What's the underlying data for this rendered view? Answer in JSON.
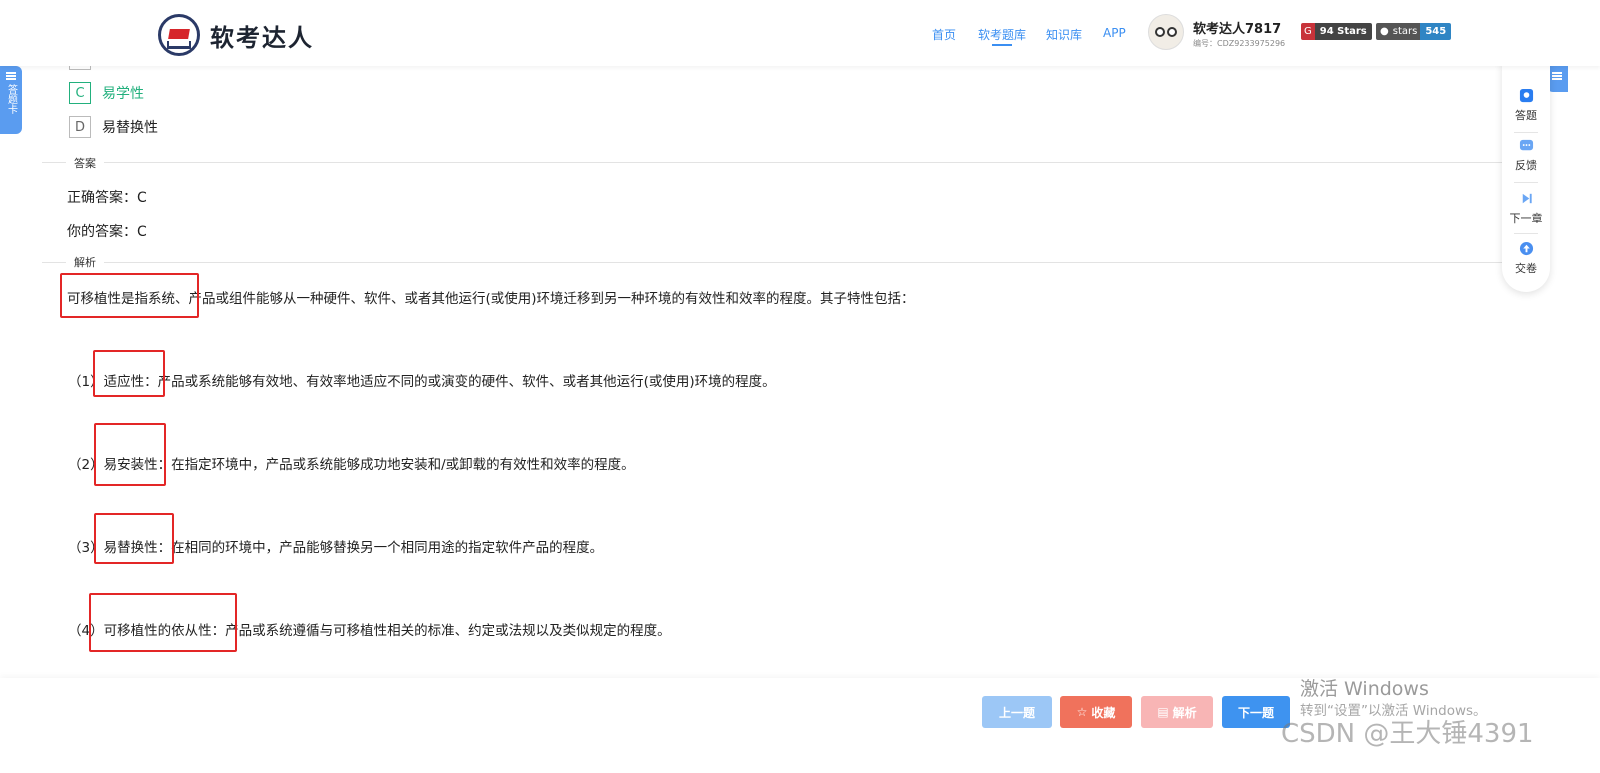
{
  "header": {
    "logo_text": "软考达人",
    "nav": [
      "首页",
      "软考题库",
      "知识库",
      "APP"
    ],
    "active_nav": "软考题库",
    "user_name": "软考达人7817",
    "user_id": "编号：CDZ9233975296",
    "gitee_badge": "94 Stars",
    "github_badge_label": "stars",
    "github_badge_count": "545"
  },
  "left_tab": {
    "label": "答题卡"
  },
  "side_toolbar": {
    "items": [
      {
        "label": "答题",
        "icon": "answer-icon"
      },
      {
        "label": "反馈",
        "icon": "feedback-icon"
      },
      {
        "label": "下一章",
        "icon": "next-chapter-icon"
      },
      {
        "label": "交卷",
        "icon": "submit-icon"
      }
    ]
  },
  "options": [
    {
      "letter": "C",
      "text": "易学性",
      "selected": true
    },
    {
      "letter": "D",
      "text": "易替换性",
      "selected": false
    }
  ],
  "answer_section": {
    "title": "答案",
    "correct_label": "正确答案：C",
    "your_label": "你的答案：C"
  },
  "analysis": {
    "title": "解析",
    "intro": "可移植性是指系统、产品或组件能够从一种硬件、软件、或者其他运行(或使用)环境迁移到另一种环境的有效性和效率的程度。其子特性包括：",
    "items": [
      "（1）适应性：产品或系统能够有效地、有效率地适应不同的或演变的硬件、软件、或者其他运行(或使用)环境的程度。",
      "（2）易安装性：在指定环境中，产品或系统能够成功地安装和/或卸载的有效性和效率的程度。",
      "（3）易替换性：在相同的环境中，产品能够替换另一个相同用途的指定软件产品的程度。",
      "（4）可移植性的依从性：产品或系统遵循与可移植性相关的标准、约定或法规以及类似规定的程度。"
    ]
  },
  "bottom_buttons": {
    "prev": "上一题",
    "favorite": "收藏",
    "analysis": "解析",
    "next": "下一题"
  },
  "watermark": {
    "activate_title": "激活 Windows",
    "activate_sub": "转到“设置”以激活 Windows。",
    "csdn": "CSDN @王大锤4391"
  },
  "colors": {
    "accent": "#3b8ff2",
    "selected_green": "#22b07d",
    "highlight_red": "#e32626"
  }
}
